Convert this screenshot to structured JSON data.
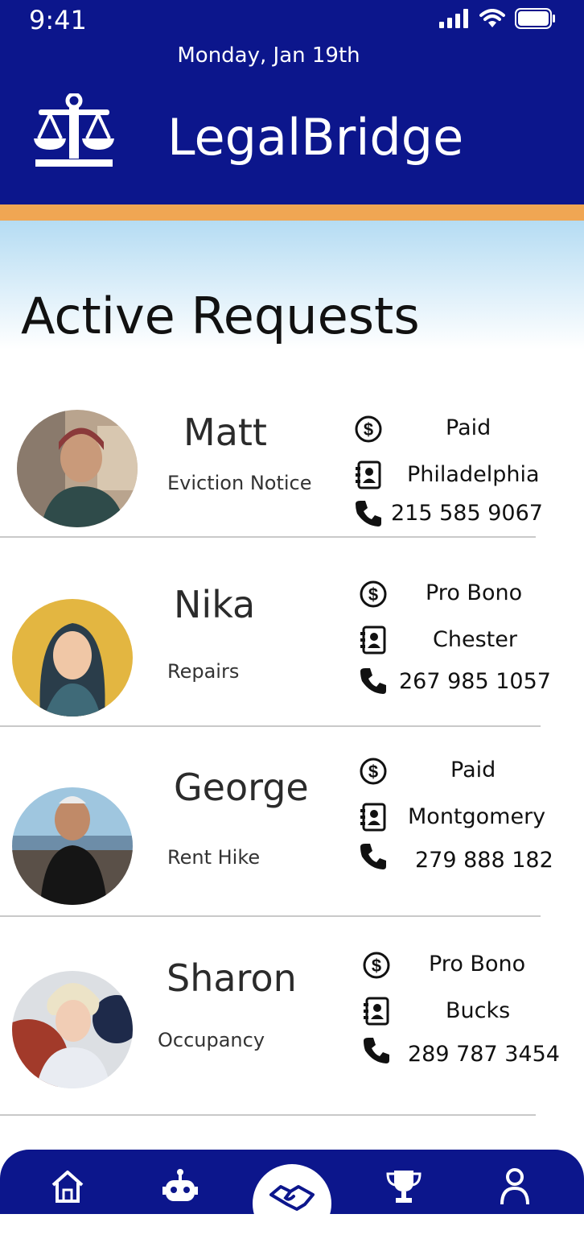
{
  "status_bar": {
    "time": "9:41"
  },
  "header": {
    "date": "Monday, Jan 19th",
    "app_name": "LegalBridge",
    "logo_icon": "scales-of-justice-icon"
  },
  "section_title": "Active Requests",
  "requests": [
    {
      "name": "Matt",
      "issue": "Eviction Notice",
      "payment": "Paid",
      "location": "Philadelphia",
      "phone": "215 585 9067"
    },
    {
      "name": "Nika",
      "issue": "Repairs",
      "payment": "Pro Bono",
      "location": "Chester",
      "phone": "267 985 1057"
    },
    {
      "name": "George",
      "issue": "Rent Hike",
      "payment": "Paid",
      "location": "Montgomery",
      "phone": "279 888 182"
    },
    {
      "name": "Sharon",
      "issue": "Occupancy",
      "payment": "Pro Bono",
      "location": "Bucks",
      "phone": "289 787 3454"
    }
  ],
  "tab_bar": {
    "icons": [
      "home-icon",
      "robot-icon",
      "handshake-icon",
      "trophy-icon",
      "profile-icon"
    ],
    "active": "handshake-icon"
  },
  "colors": {
    "primary": "#0c168c",
    "accent": "#f0a653",
    "sky": "#b5dcf3"
  }
}
